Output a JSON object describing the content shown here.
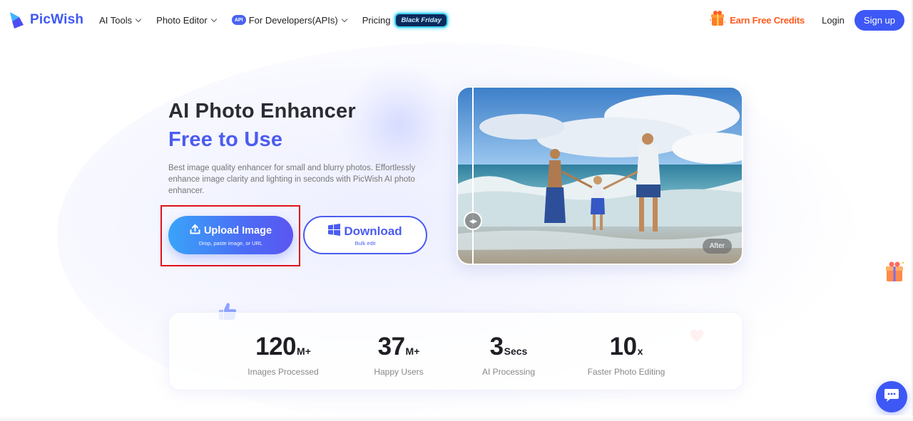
{
  "header": {
    "logo_text": "PicWish",
    "nav": [
      {
        "label": "AI Tools"
      },
      {
        "label": "Photo Editor"
      },
      {
        "label": "For Developers(APIs)",
        "badge": "API"
      },
      {
        "label": "Pricing"
      }
    ],
    "promo_badge": "Black Friday",
    "earn_credits": "Earn Free Credits",
    "login": "Login",
    "signup": "Sign up"
  },
  "hero": {
    "title": "AI Photo Enhancer",
    "subtitle": "Free to Use",
    "description": "Best image quality enhancer for small and blurry photos. Effortlessly enhance image clarity and lighting in seconds with PicWish AI photo enhancer.",
    "upload": {
      "label": "Upload Image",
      "sub": "Drop, paste image, or URL"
    },
    "download": {
      "label": "Download",
      "sub": "Bulk edit"
    },
    "compare_label": "After"
  },
  "stats": [
    {
      "value": "120",
      "unit": "M+",
      "label": "Images Processed"
    },
    {
      "value": "37",
      "unit": "M+",
      "label": "Happy Users"
    },
    {
      "value": "3",
      "unit": "Secs",
      "label": "AI Processing"
    },
    {
      "value": "10",
      "unit": "x",
      "label": "Faster Photo Editing"
    }
  ],
  "colors": {
    "brand": "#3d58f5",
    "accent_text": "#4b5cf0",
    "highlight_box": "#e0121b",
    "earn_credits": "#ff5a1f"
  },
  "icons": [
    "picwish-logo-icon",
    "chevron-down-icon",
    "api-icon",
    "gift-icon",
    "upload-icon",
    "windows-icon",
    "compare-handle-icon",
    "thumbs-up-icon",
    "heart-icon",
    "chat-icon"
  ]
}
